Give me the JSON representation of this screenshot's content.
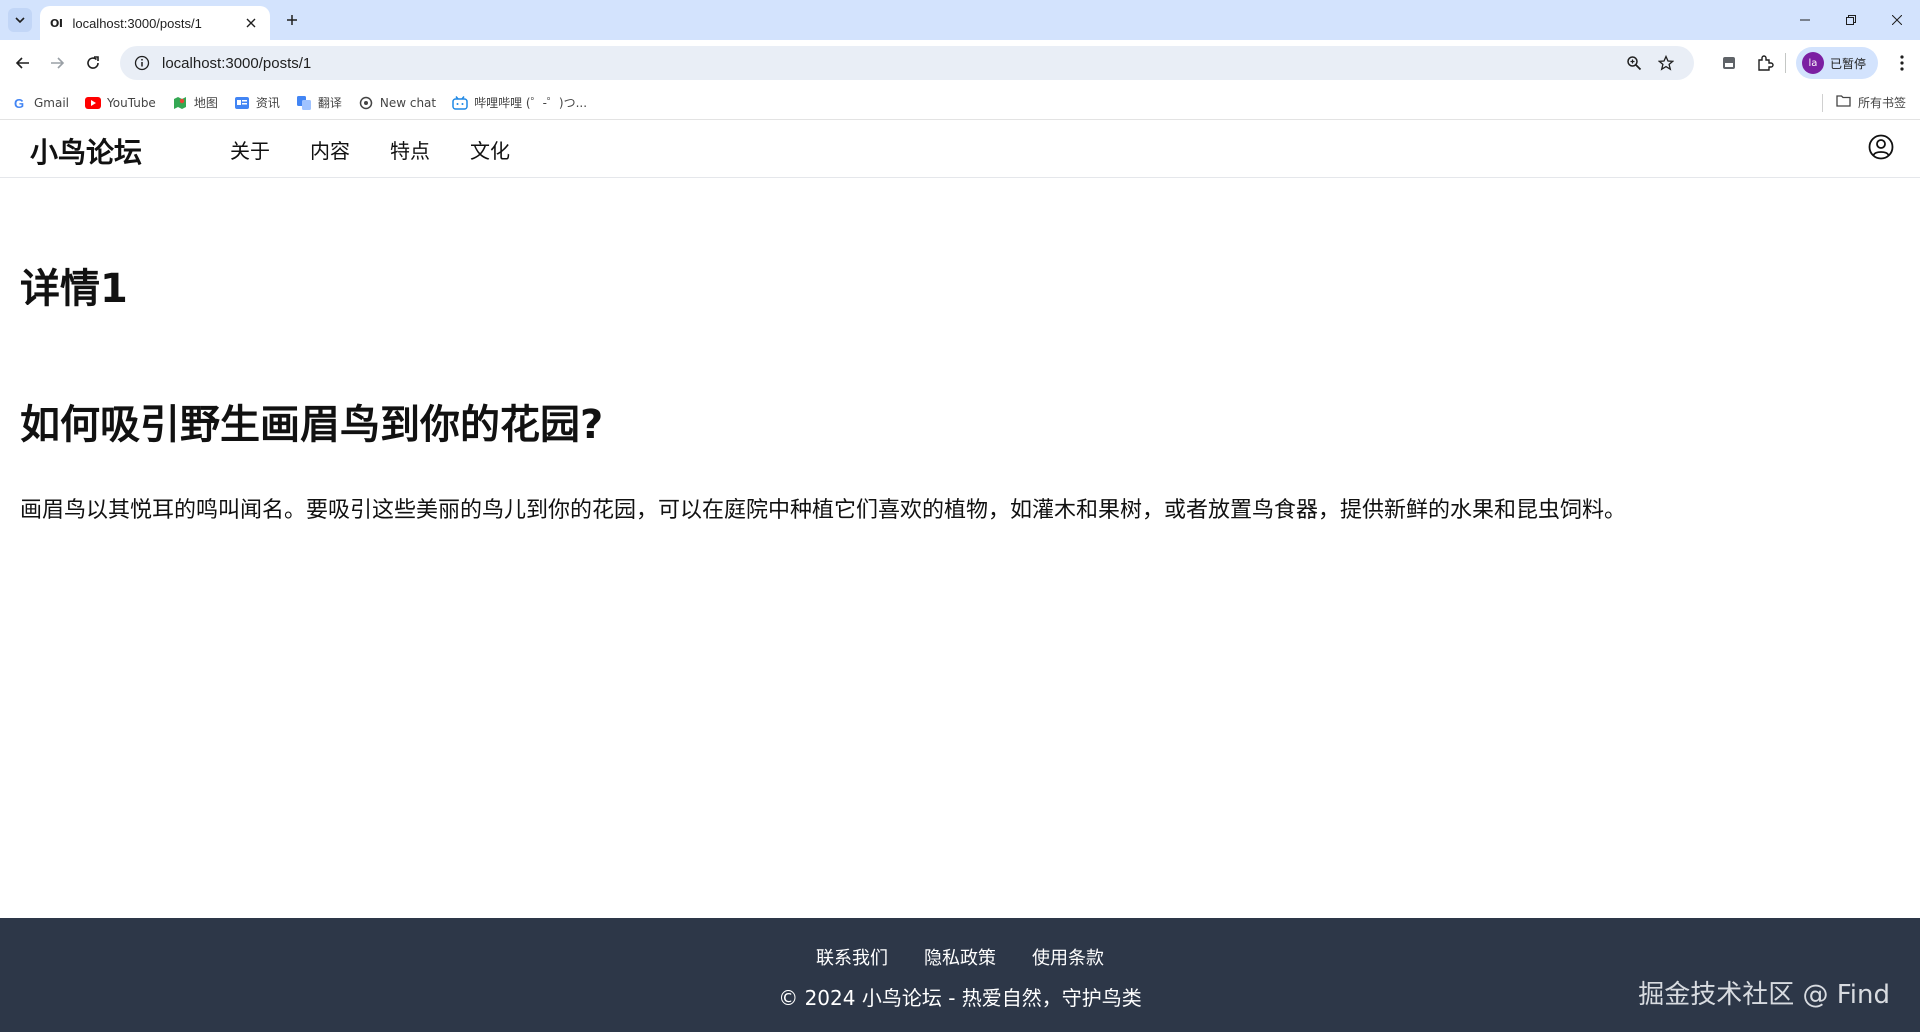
{
  "browser": {
    "tab_title": "localhost:3000/posts/1",
    "tab_favicon": "OI",
    "url": "localhost:3000/posts/1",
    "profile_label": "已暂停",
    "profile_avatar": "la",
    "bookmarks": [
      {
        "label": "Gmail",
        "icon": "google-icon"
      },
      {
        "label": "YouTube",
        "icon": "youtube-icon"
      },
      {
        "label": "地图",
        "icon": "maps-icon"
      },
      {
        "label": "资讯",
        "icon": "news-icon"
      },
      {
        "label": "翻译",
        "icon": "translate-icon"
      },
      {
        "label": "New chat",
        "icon": "chat-icon"
      },
      {
        "label": "哔哩哔哩 (゜-゜)つ...",
        "icon": "bilibili-icon"
      }
    ],
    "all_bookmarks": "所有书签"
  },
  "site": {
    "logo": "小鸟论坛",
    "nav": [
      "关于",
      "内容",
      "特点",
      "文化"
    ]
  },
  "main": {
    "detail_title": "详情1",
    "post_title": "如何吸引野生画眉鸟到你的花园?",
    "post_body": "画眉鸟以其悦耳的鸣叫闻名。要吸引这些美丽的鸟儿到你的花园，可以在庭院中种植它们喜欢的植物，如灌木和果树，或者放置鸟食器，提供新鲜的水果和昆虫饲料。"
  },
  "footer": {
    "links": [
      "联系我们",
      "隐私政策",
      "使用条款"
    ],
    "copyright": "© 2024 小鸟论坛 - 热爱自然，守护鸟类",
    "watermark": "掘金技术社区 @ Find"
  },
  "colors": {
    "tabstrip": "#d3e3fd",
    "footer_bg": "#2d3748",
    "profile_avatar_bg": "#7b1fa2"
  }
}
